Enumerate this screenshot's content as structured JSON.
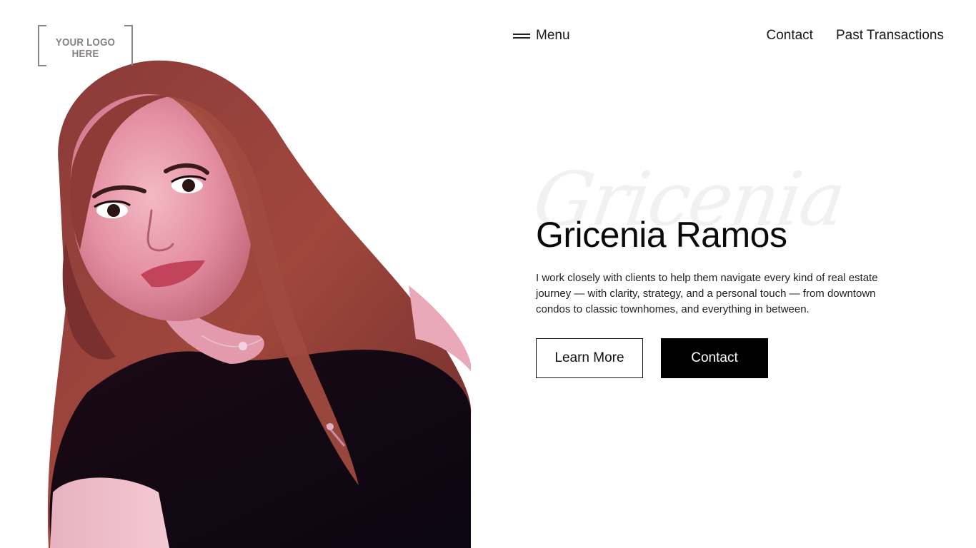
{
  "logo": {
    "text": "YOUR LOGO HERE"
  },
  "nav": {
    "menu_label": "Menu",
    "links": [
      {
        "label": "Contact"
      },
      {
        "label": "Past Transactions"
      }
    ]
  },
  "hero": {
    "script_bg": "Gricenia",
    "name": "Gricenia Ramos",
    "description": "I work closely with clients to help them navigate every kind of real estate journey — with clarity, strategy, and a personal touch — from downtown condos to classic townhomes, and everything in between.",
    "primary_button": "Learn More",
    "secondary_button": "Contact"
  },
  "colors": {
    "background": "#ffffff",
    "text": "#0a0a0a",
    "button_dark": "#000000",
    "logo_gray": "#868084"
  }
}
